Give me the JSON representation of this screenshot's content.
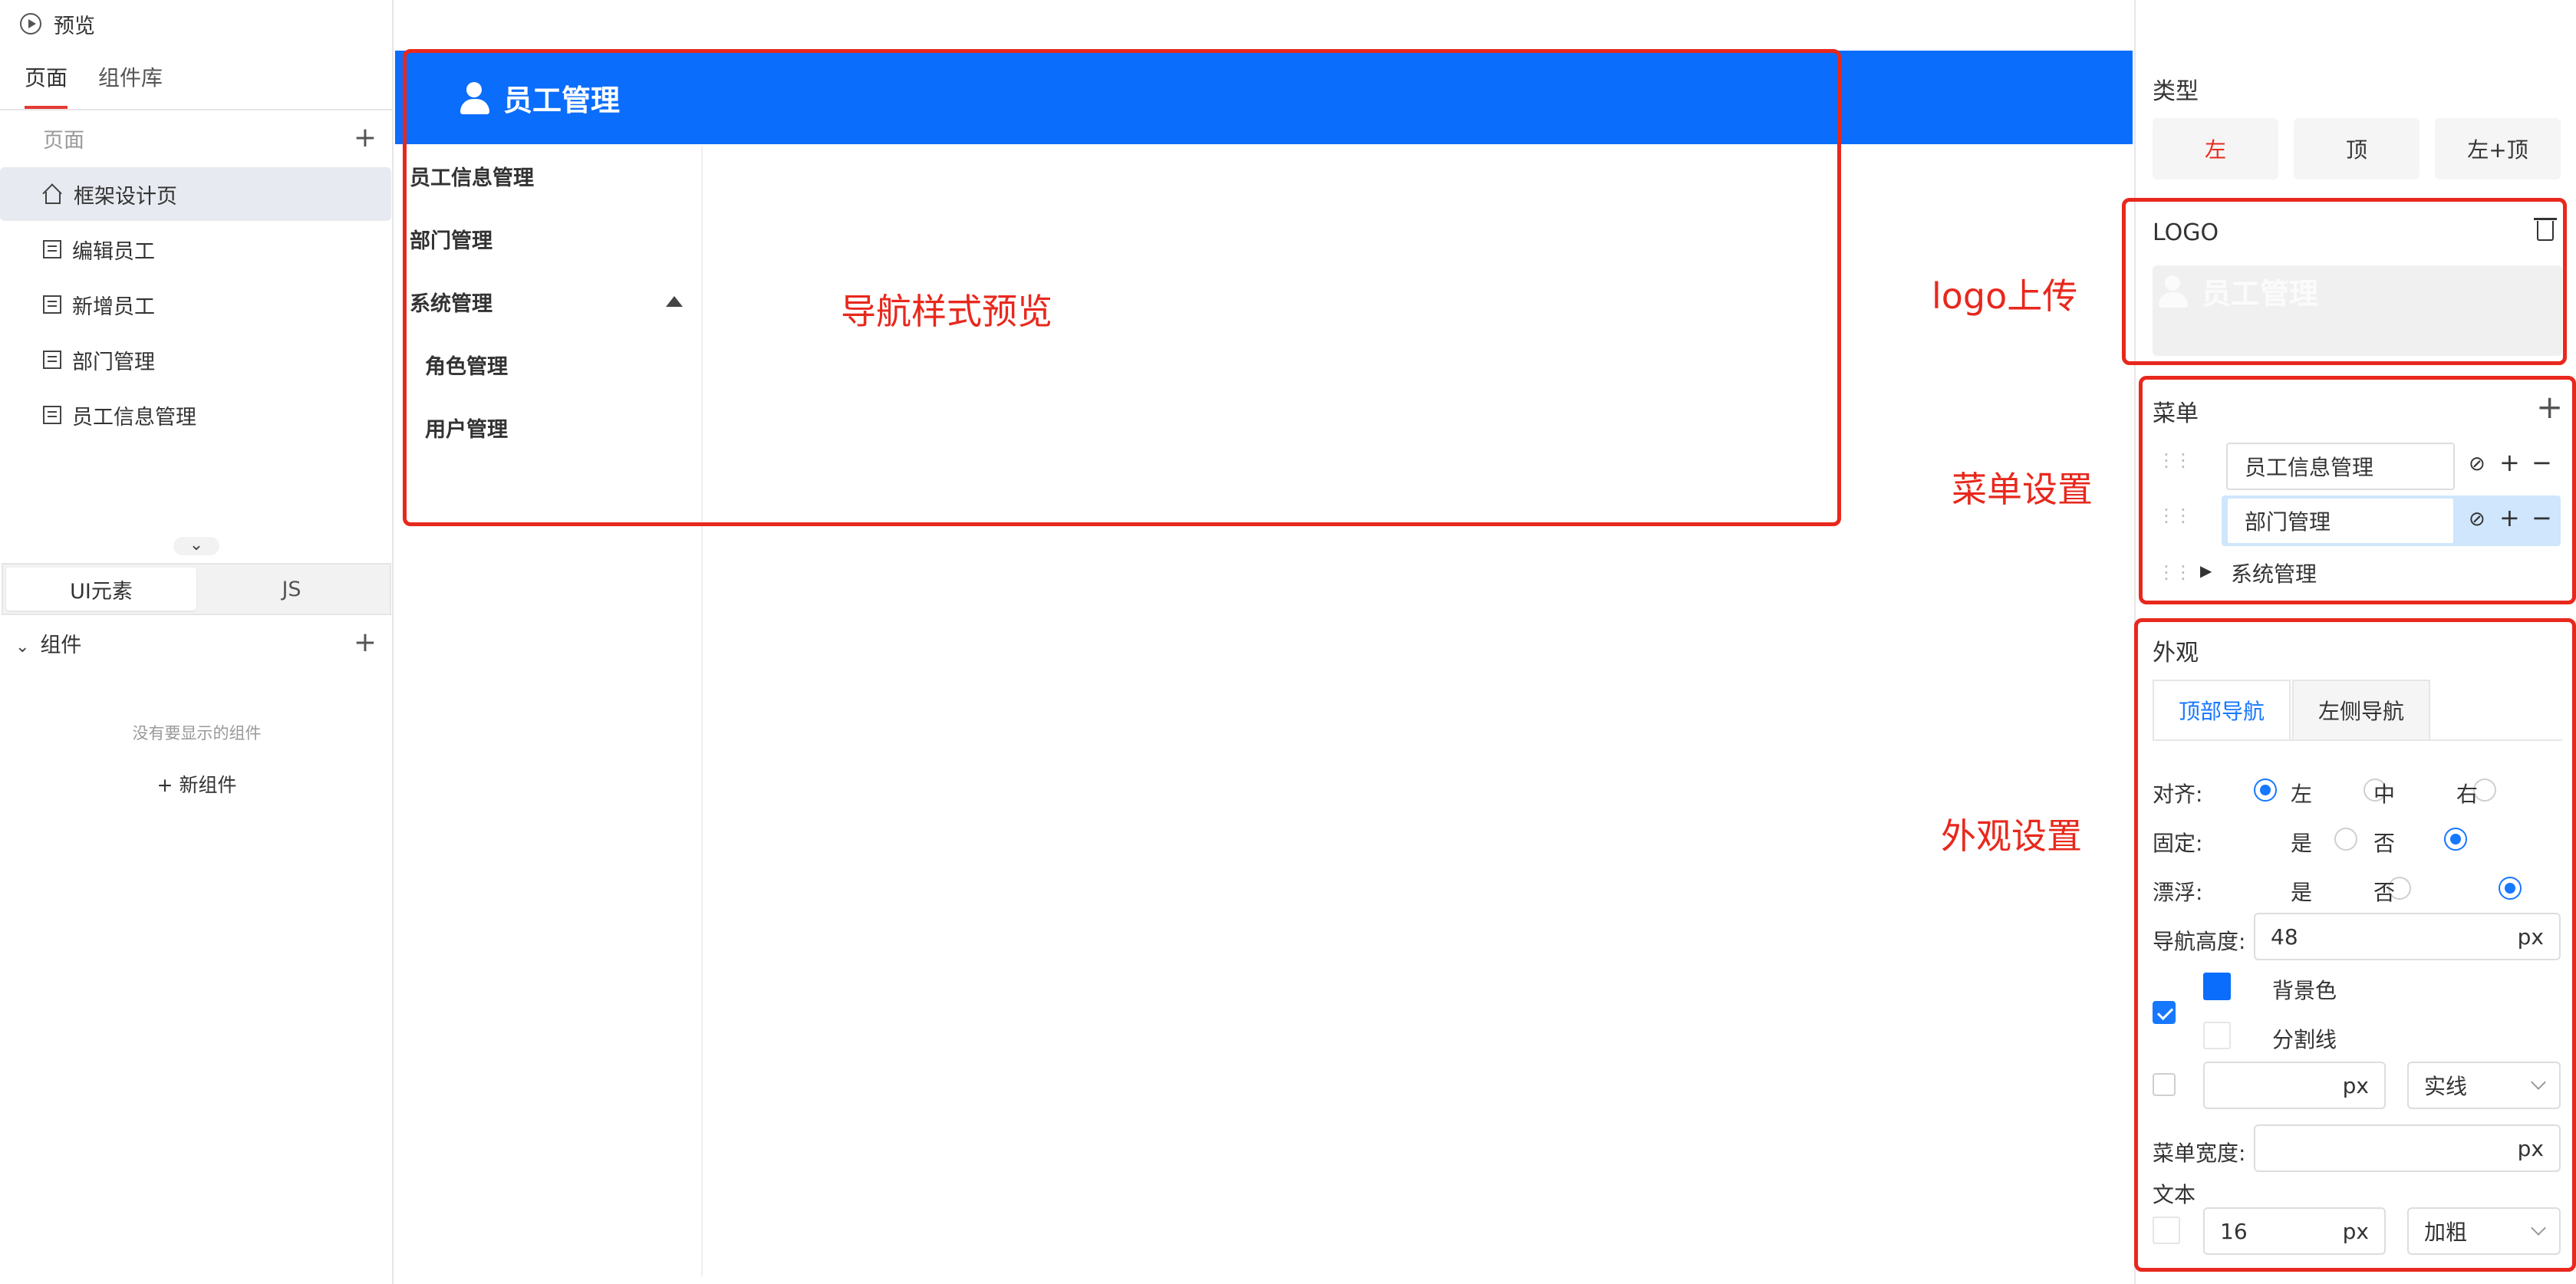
{
  "left": {
    "preview_label": "预览",
    "tabs": [
      "页面",
      "组件库"
    ],
    "pages_header": "页面",
    "pages": [
      "框架设计页",
      "编辑员工",
      "新增员工",
      "部门管理",
      "员工信息管理"
    ],
    "seg": [
      "UI元素",
      "JS"
    ],
    "components_header": "组件",
    "empty_text": "没有要显示的组件",
    "new_component": "+ 新组件"
  },
  "preview": {
    "brand": "员工管理",
    "menu": [
      "员工信息管理",
      "部门管理",
      "系统管理"
    ],
    "submenu": [
      "角色管理",
      "用户管理"
    ],
    "nav_color": "#0b6dfc"
  },
  "annotations": {
    "nav_preview": "导航样式预览",
    "logo_upload": "logo上传",
    "menu_settings": "菜单设置",
    "appearance_settings": "外观设置",
    "color": "#e8281d"
  },
  "right": {
    "type_label": "类型",
    "type_buttons": [
      "左",
      "顶",
      "左+顶"
    ],
    "type_selected": "左",
    "logo_label": "LOGO",
    "logo_preview": "员工管理",
    "menu_label": "菜单",
    "menu_items": [
      "员工信息管理",
      "部门管理"
    ],
    "menu_group": "系统管理",
    "appearance_label": "外观",
    "appearance_tabs": [
      "顶部导航",
      "左侧导航"
    ],
    "align_label": "对齐:",
    "align_options": [
      "左",
      "中",
      "右"
    ],
    "fixed_label": "固定:",
    "float_label": "漂浮:",
    "yes": "是",
    "no": "否",
    "nav_height_label": "导航高度:",
    "nav_height_value": "48",
    "unit_px": "px",
    "bg_color_label": "背景色",
    "divider_label": "分割线",
    "line_style": "实线",
    "menu_width_label": "菜单宽度:",
    "text_label": "文本",
    "font_size": "16",
    "font_weight": "加粗"
  }
}
